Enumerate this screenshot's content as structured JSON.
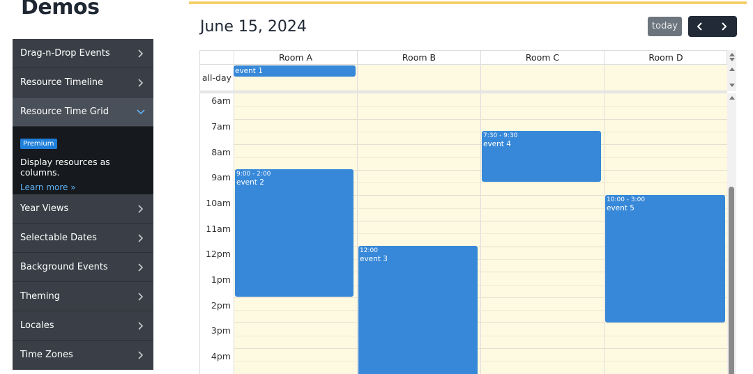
{
  "page": {
    "title": "Demos"
  },
  "sidebar": {
    "items": [
      {
        "label": "Drag-n-Drop Events"
      },
      {
        "label": "Resource Timeline"
      },
      {
        "label": "Resource Time Grid"
      },
      {
        "label": "Year Views"
      },
      {
        "label": "Selectable Dates"
      },
      {
        "label": "Background Events"
      },
      {
        "label": "Theming"
      },
      {
        "label": "Locales"
      },
      {
        "label": "Time Zones"
      }
    ],
    "active_panel": {
      "badge": "Premium",
      "description": "Display resources as columns.",
      "link": "Learn more »"
    }
  },
  "calendar": {
    "title": "June 15, 2024",
    "today_label": "today",
    "allday_label": "all-day",
    "resources": [
      "Room A",
      "Room B",
      "Room C",
      "Room D"
    ],
    "hours": [
      "6am",
      "7am",
      "8am",
      "9am",
      "10am",
      "11am",
      "12pm",
      "1pm",
      "2pm",
      "3pm",
      "4pm"
    ],
    "allday_events": [
      {
        "title": "event 1",
        "resource": "Room A"
      }
    ],
    "events": [
      {
        "title": "event 2",
        "time": "9:00 - 2:00",
        "resource": "Room A"
      },
      {
        "title": "event 3",
        "time": "12:00",
        "resource": "Room B"
      },
      {
        "title": "event 4",
        "time": "7:30 - 9:30",
        "resource": "Room C"
      },
      {
        "title": "event 5",
        "time": "10:00 - 3:00",
        "resource": "Room D"
      }
    ],
    "colors": {
      "event": "#3788d8",
      "today_bg": "#fef9e1",
      "accent": "#f5cf6a"
    }
  }
}
